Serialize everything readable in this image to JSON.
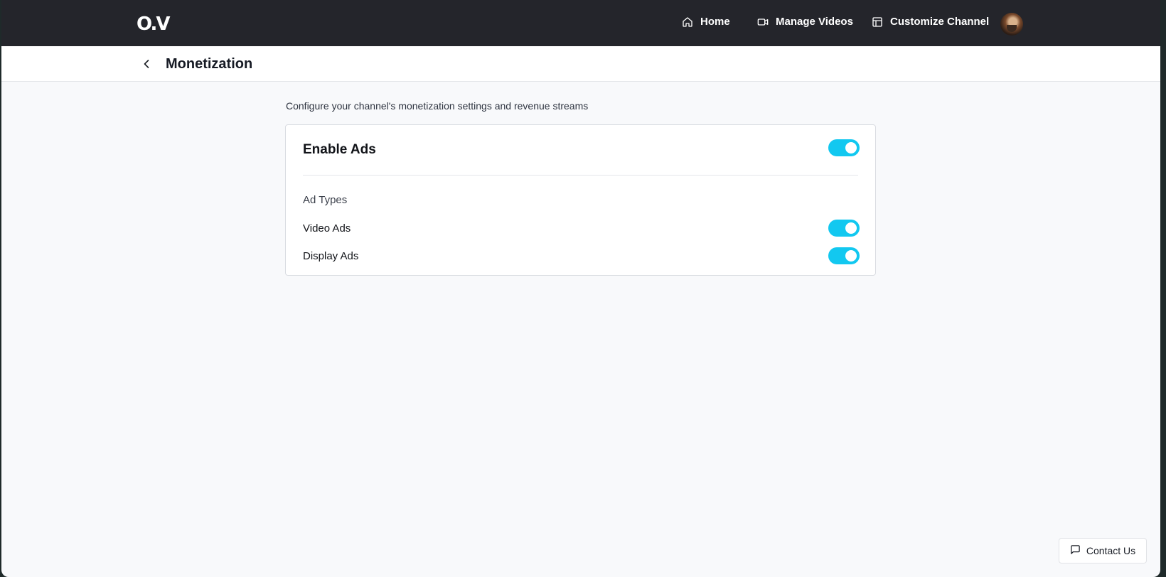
{
  "header": {
    "logo": "O.V",
    "nav": [
      {
        "label": "Home",
        "icon": "home-icon"
      },
      {
        "label": "Manage Videos",
        "icon": "video-camera-icon"
      },
      {
        "label": "Customize Channel",
        "icon": "layout-icon"
      }
    ],
    "avatar": "user-avatar"
  },
  "subheader": {
    "back_icon": "chevron-left-icon",
    "title": "Monetization"
  },
  "main": {
    "description": "Configure your channel's monetization settings and revenue streams",
    "card": {
      "title": "Enable Ads",
      "enable_ads_on": true,
      "section_label": "Ad Types",
      "rows": [
        {
          "label": "Video Ads",
          "on": true
        },
        {
          "label": "Display Ads",
          "on": true
        }
      ]
    }
  },
  "contact": {
    "label": "Contact Us",
    "icon": "message-square-icon"
  },
  "colors": {
    "topbar": "#24252b",
    "toggle_on": "#12c8f0",
    "background": "#f8f9fb"
  }
}
